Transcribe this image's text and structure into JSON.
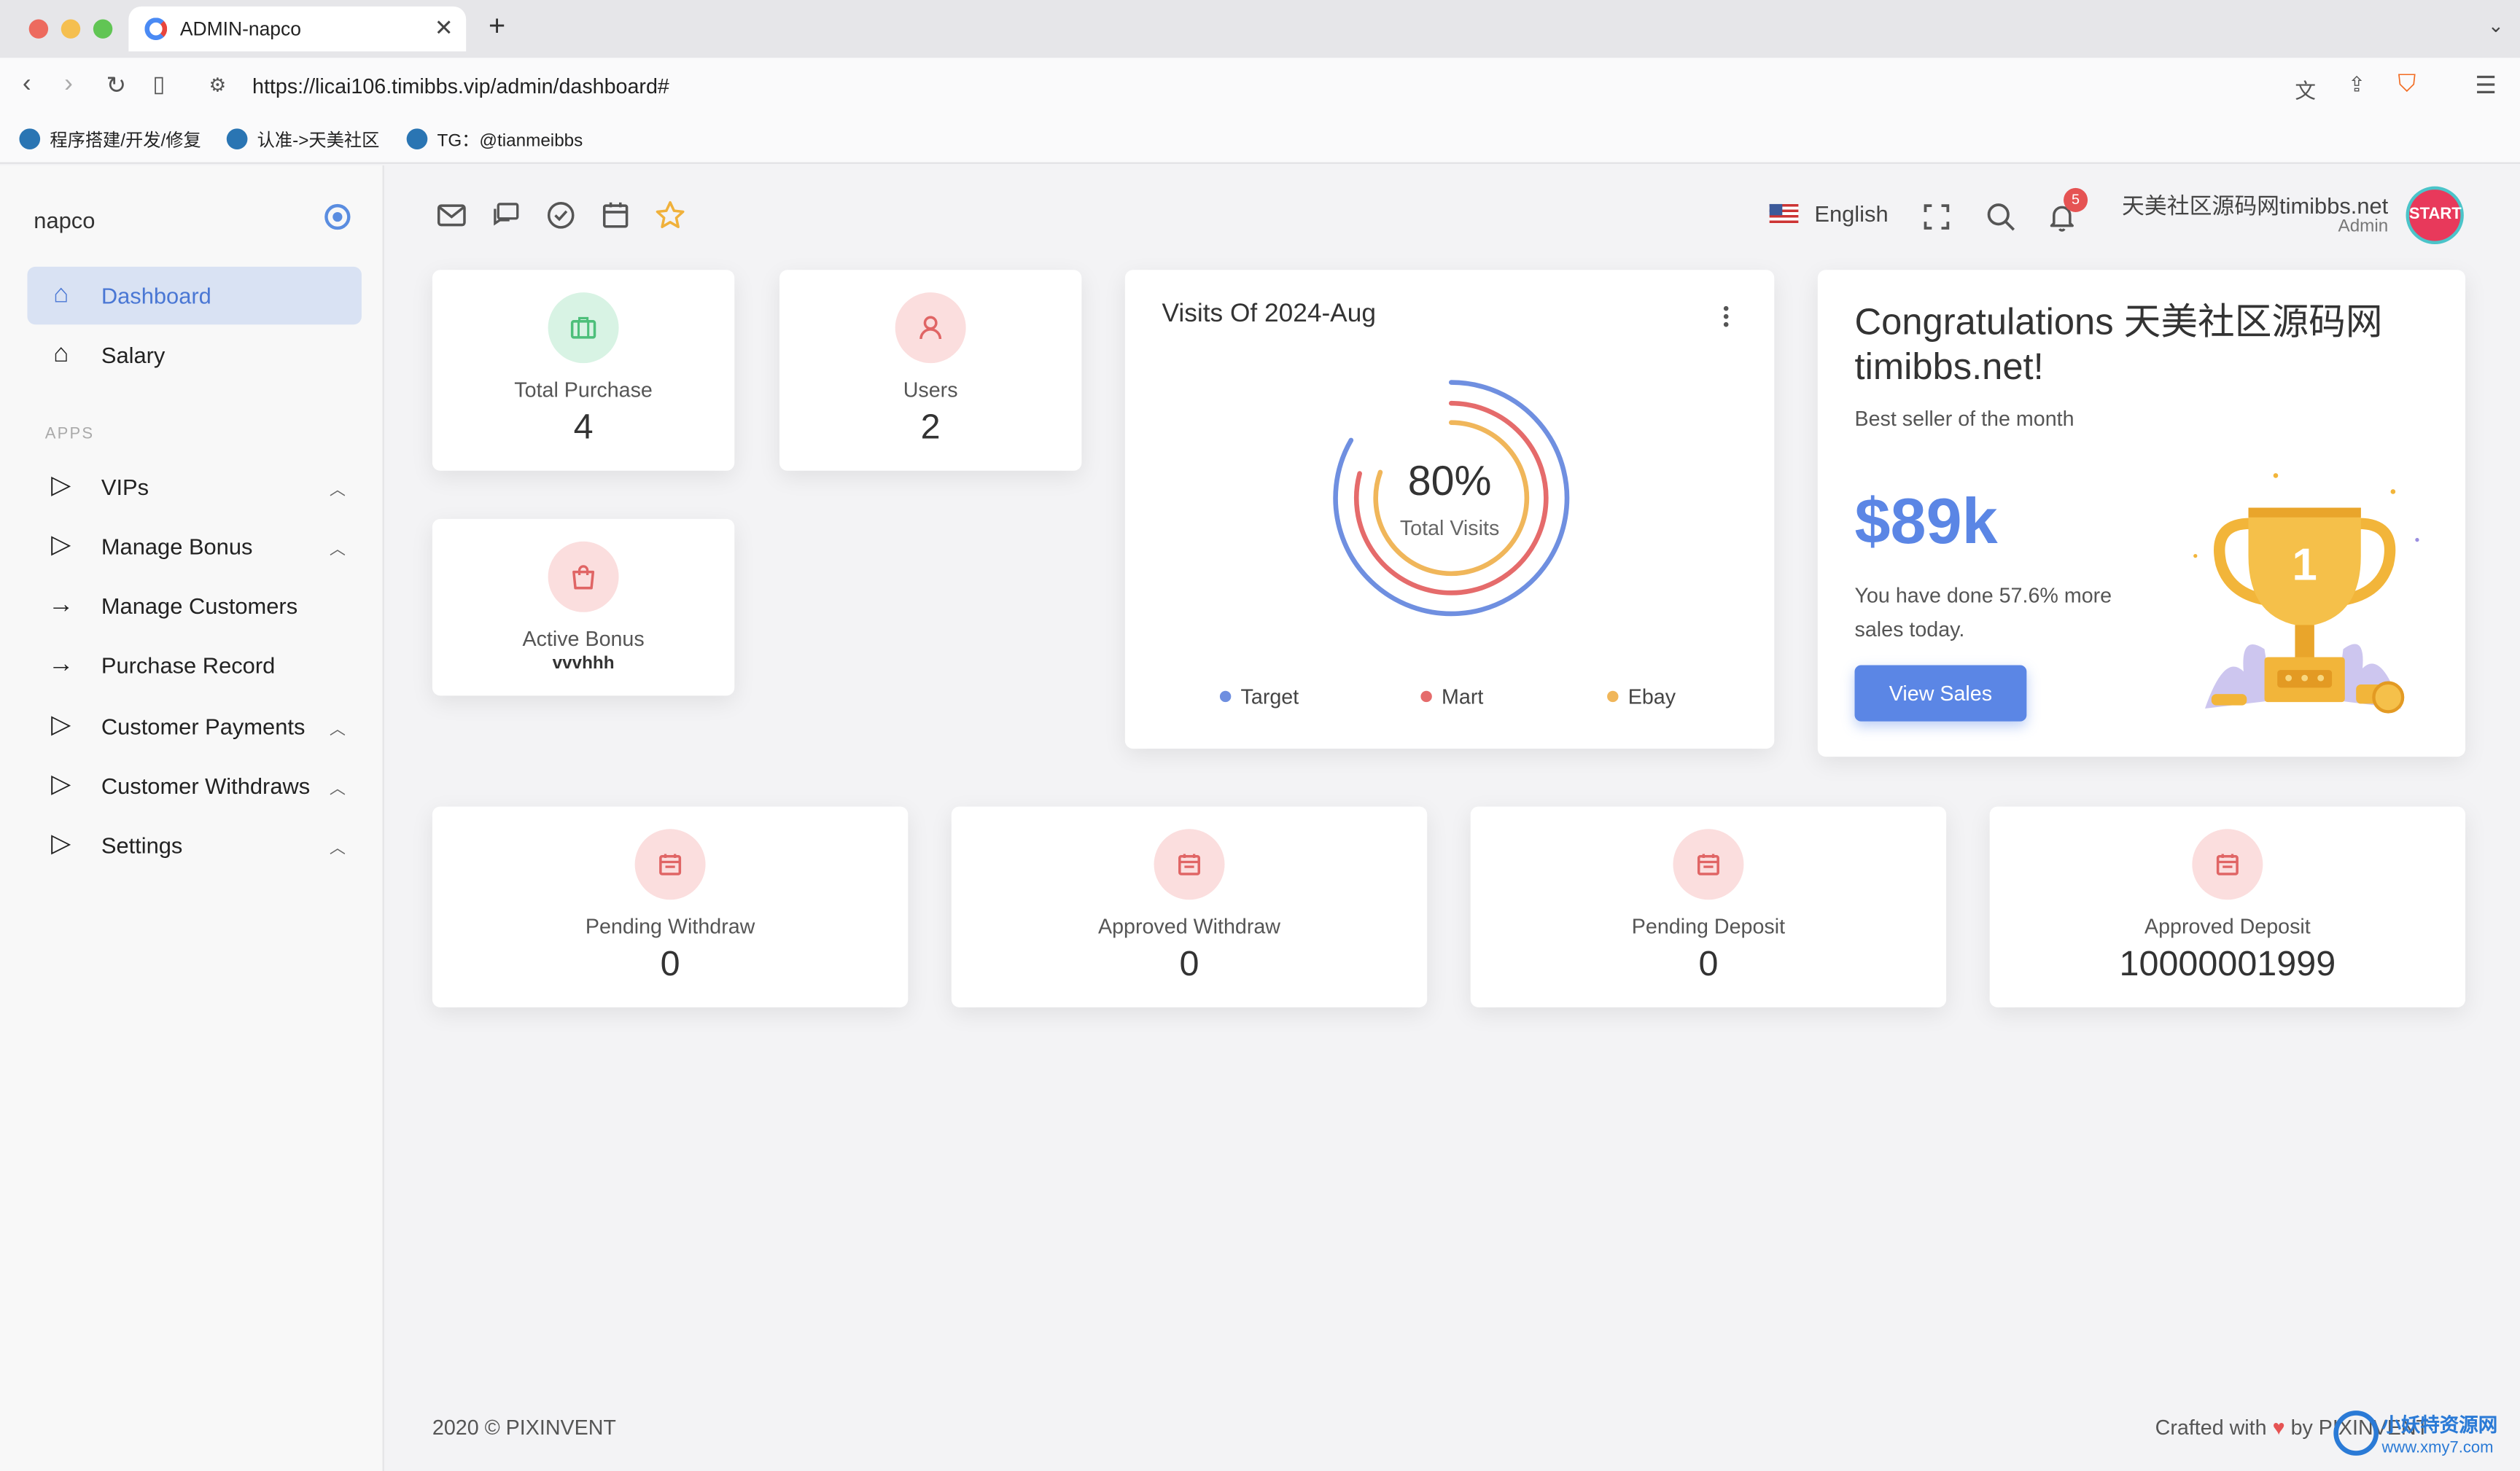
{
  "browser": {
    "tab_title": "ADMIN-napco",
    "url": "https://licai106.timibbs.vip/admin/dashboard#",
    "bookmarks": [
      "程序搭建/开发/修复",
      "认准->天美社区",
      "TG：@tianmeibbs"
    ]
  },
  "sidebar": {
    "brand": "napco",
    "section_label": "APPS",
    "items": [
      {
        "label": "Dashboard",
        "icon": "home-icon"
      },
      {
        "label": "Salary",
        "icon": "home-icon"
      },
      {
        "label": "VIPs",
        "icon": "play-icon"
      },
      {
        "label": "Manage Bonus",
        "icon": "play-icon"
      },
      {
        "label": "Manage Customers",
        "icon": "arrow-right-icon"
      },
      {
        "label": "Purchase Record",
        "icon": "arrow-right-icon"
      },
      {
        "label": "Customer Payments",
        "icon": "play-icon"
      },
      {
        "label": "Customer Withdraws",
        "icon": "play-icon"
      },
      {
        "label": "Settings",
        "icon": "play-icon"
      }
    ]
  },
  "header": {
    "language": "English",
    "notification_count": "5",
    "user_name": "天美社区源码网timibbs.net",
    "user_role": "Admin",
    "avatar_text": "START"
  },
  "stats": {
    "total_purchase": {
      "label": "Total Purchase",
      "value": "4"
    },
    "users": {
      "label": "Users",
      "value": "2"
    },
    "active_bonus": {
      "label": "Active Bonus",
      "value": "vvvhhh"
    },
    "pending_withdraw": {
      "label": "Pending Withdraw",
      "value": "0"
    },
    "approved_withdraw": {
      "label": "Approved Withdraw",
      "value": "0"
    },
    "pending_deposit": {
      "label": "Pending Deposit",
      "value": "0"
    },
    "approved_deposit": {
      "label": "Approved Deposit",
      "value": "10000001999"
    }
  },
  "visits": {
    "title": "Visits Of 2024-Aug",
    "center_value": "80%",
    "center_label": "Total Visits",
    "legend": [
      {
        "label": "Target",
        "color": "#6f8fe0"
      },
      {
        "label": "Mart",
        "color": "#e56b6b"
      },
      {
        "label": "Ebay",
        "color": "#f0b65a"
      }
    ]
  },
  "chart_data": {
    "type": "pie",
    "title": "Visits Of 2024-Aug",
    "categories": [
      "Target",
      "Mart",
      "Ebay"
    ],
    "center_value": "80%"
  },
  "congrats": {
    "title": "Congratulations 天美社区源码网timibbs.net!",
    "subtitle": "Best seller of the month",
    "amount": "$89k",
    "description": "You have done 57.6% more sales today.",
    "button": "View Sales",
    "trophy_number": "1"
  },
  "footer": {
    "left": "2020 © PIXINVENT",
    "right_prefix": "Crafted with",
    "right_suffix": "by PIXINVENT",
    "watermark_line1": "小妖特资源网",
    "watermark_line2": "www.xmy7.com"
  },
  "colors": {
    "accent": "#5b86e5",
    "green_bubble": "#d8f3e4",
    "red_bubble": "#fbdede"
  }
}
